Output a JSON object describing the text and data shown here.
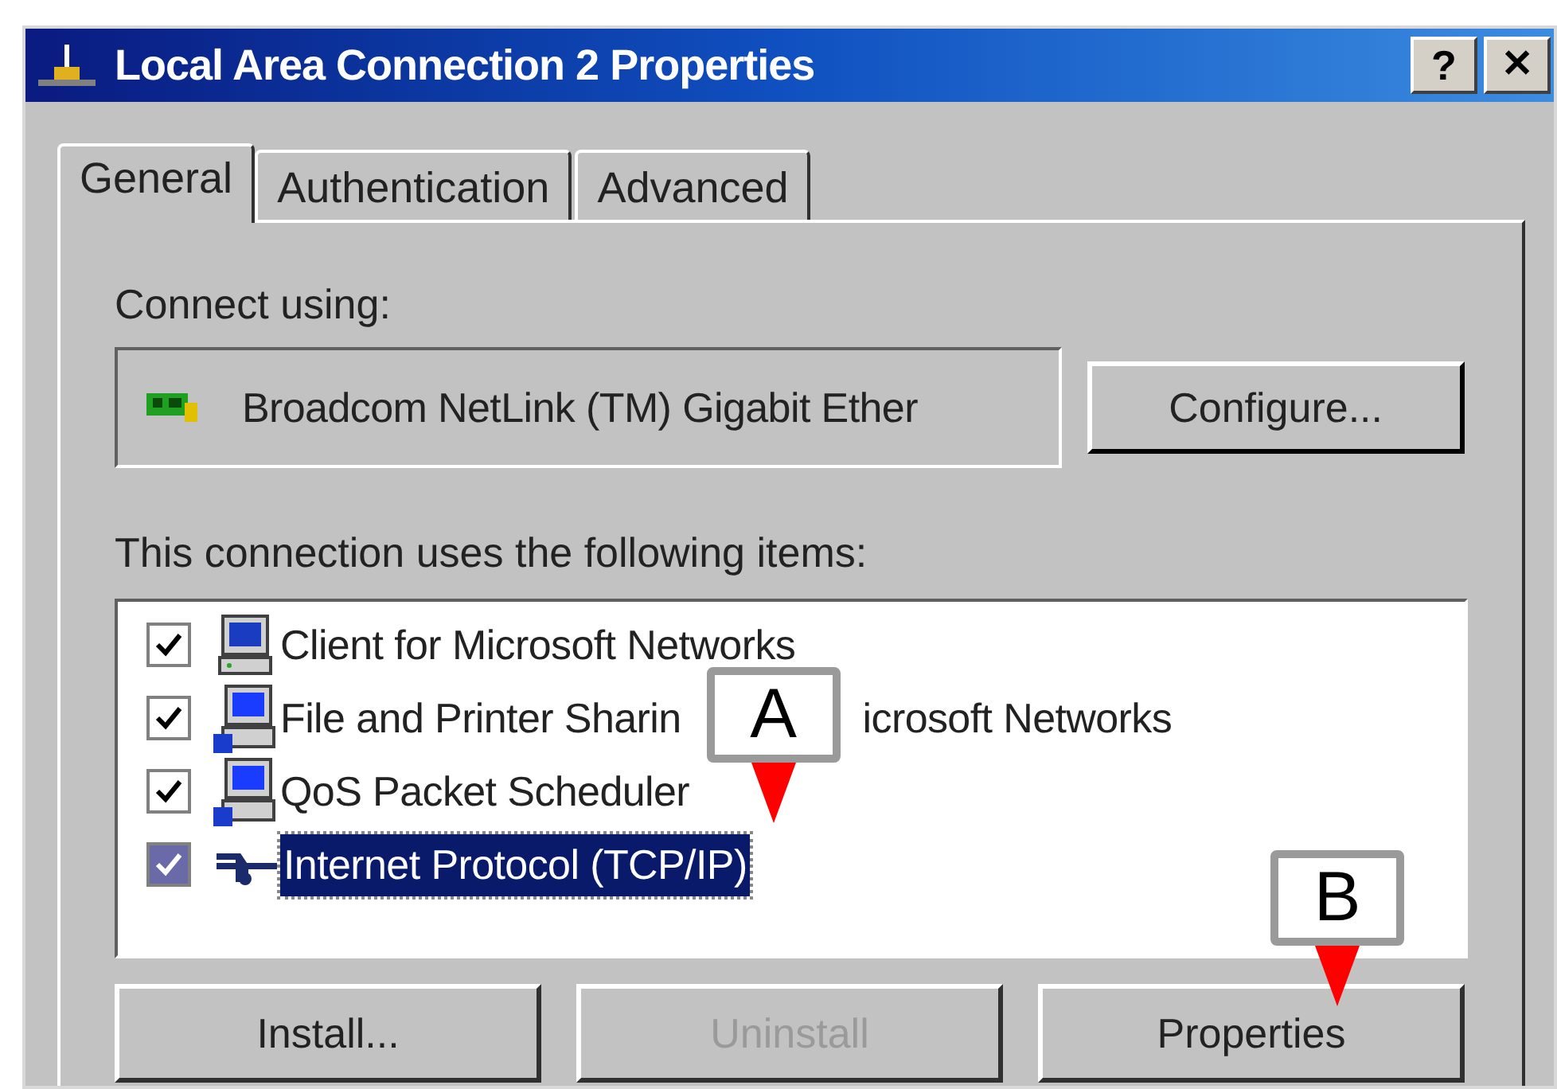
{
  "window": {
    "title": "Local Area Connection 2 Properties",
    "help": "?",
    "close": "✕"
  },
  "tabs": [
    {
      "label": "General",
      "selected": true
    },
    {
      "label": "Authentication",
      "selected": false
    },
    {
      "label": "Advanced",
      "selected": false
    }
  ],
  "connect_using": {
    "label": "Connect using:",
    "adapter": "Broadcom NetLink (TM) Gigabit Ether",
    "button": "Configure..."
  },
  "items_label": "This connection uses the following items:",
  "items": [
    {
      "kind": "client",
      "label": "Client for Microsoft Networks",
      "checked": true,
      "selected": false
    },
    {
      "kind": "service",
      "label_parts": [
        "File and Printer Sharin",
        "icrosoft Networks"
      ],
      "checked": true,
      "selected": false
    },
    {
      "kind": "service",
      "label": "QoS Packet Scheduler",
      "checked": true,
      "selected": false
    },
    {
      "kind": "protocol",
      "label": "Internet Protocol (TCP/IP)",
      "checked": true,
      "selected": true
    }
  ],
  "buttons": [
    {
      "label": "Install...",
      "disabled": false
    },
    {
      "label": "Uninstall",
      "disabled": true
    },
    {
      "label": "Properties",
      "disabled": false
    }
  ],
  "callouts": [
    {
      "label": "A"
    },
    {
      "label": "B"
    }
  ]
}
